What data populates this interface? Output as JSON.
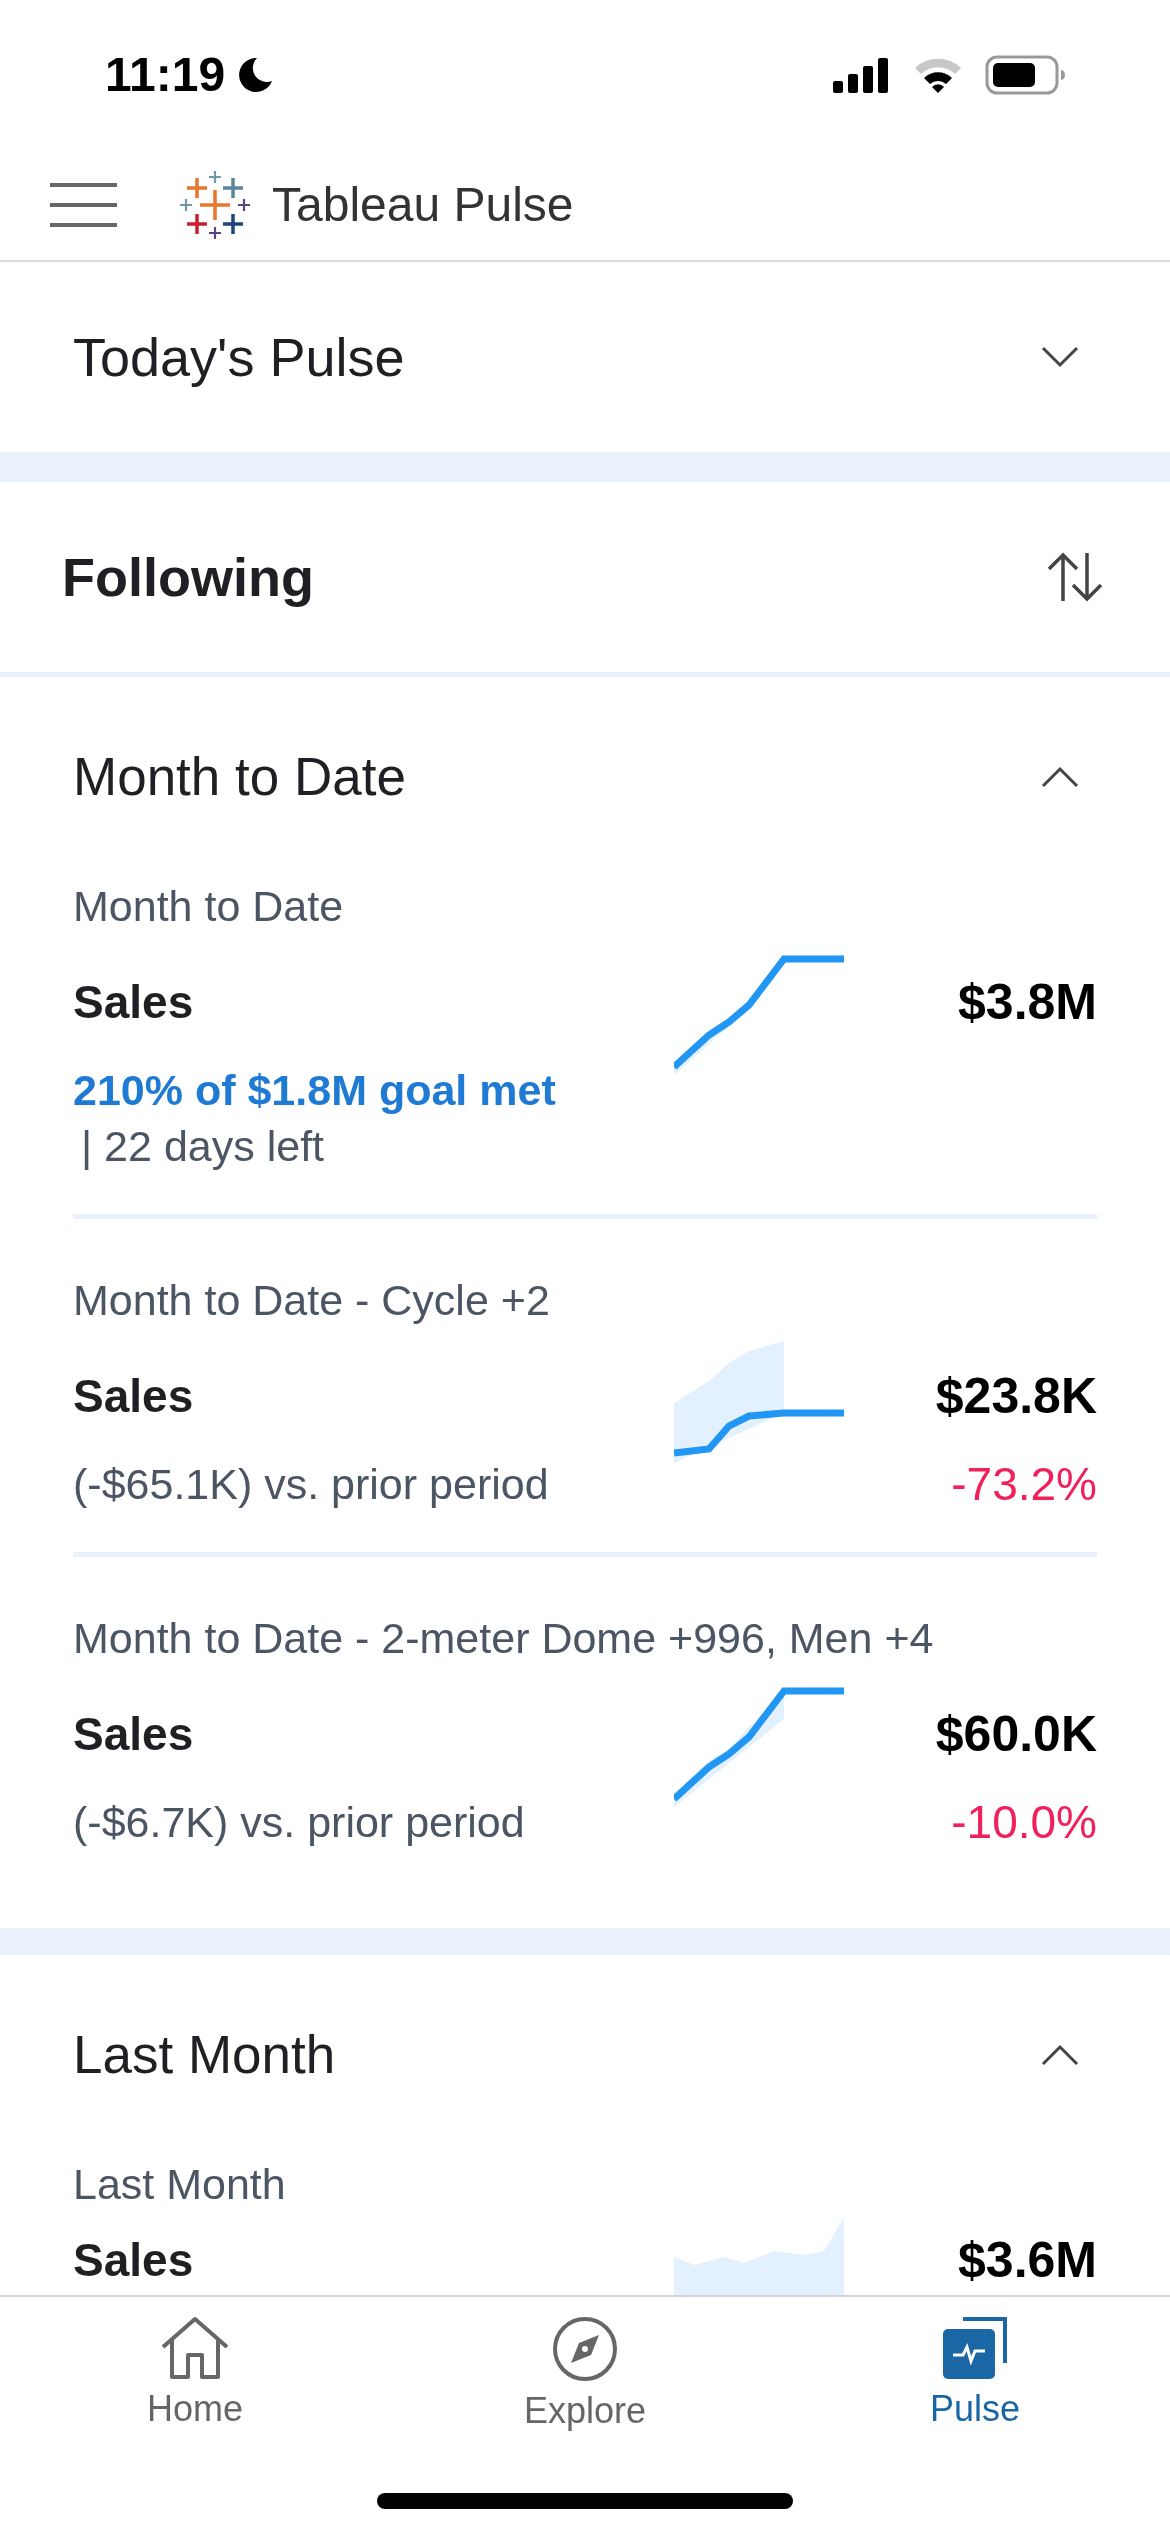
{
  "status_bar": {
    "time": "11:19"
  },
  "header": {
    "title": "Tableau Pulse"
  },
  "todays_pulse": {
    "title": "Today's Pulse",
    "expanded": false
  },
  "following": {
    "title": "Following"
  },
  "groups": [
    {
      "title": "Month to Date",
      "expanded": true,
      "metrics": [
        {
          "kind": "goal",
          "label": "Month to Date",
          "name": "Sales",
          "value": "$3.8M",
          "goal": "210% of $1.8M goal met",
          "note": "| 22 days left"
        },
        {
          "kind": "change",
          "label": "Month to Date - Cycle +2",
          "name": "Sales",
          "value": "$23.8K",
          "comparison": "(-$65.1K) vs. prior period",
          "change": "-73.2%"
        },
        {
          "kind": "change",
          "label": "Month to Date - 2-meter Dome +996, Men +4",
          "name": "Sales",
          "value": "$60.0K",
          "comparison": "(-$6.7K) vs. prior period",
          "change": "-10.0%"
        }
      ]
    },
    {
      "title": "Last Month",
      "expanded": true,
      "metrics": [
        {
          "kind": "partial",
          "label": "Last Month",
          "name": "Sales",
          "value": "$3.6M"
        }
      ]
    }
  ],
  "tabs": [
    {
      "label": "Home",
      "selected": false
    },
    {
      "label": "Explore",
      "selected": false
    },
    {
      "label": "Pulse",
      "selected": true
    }
  ]
}
